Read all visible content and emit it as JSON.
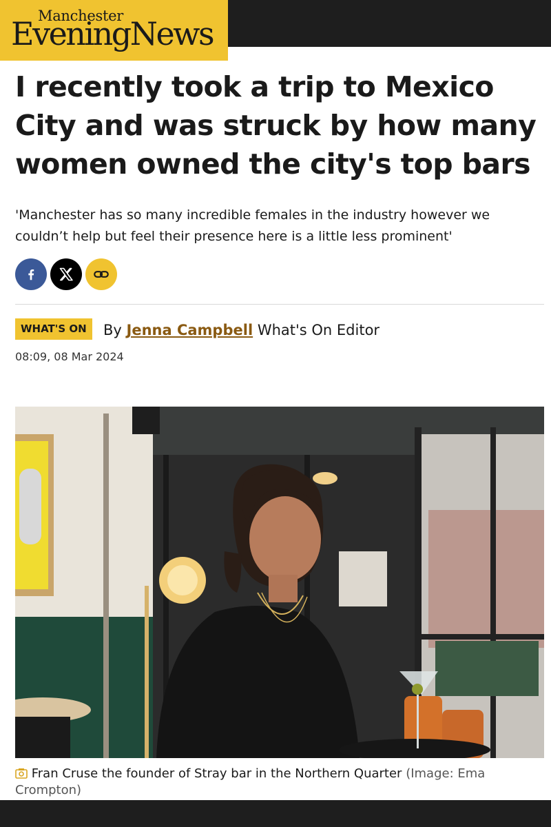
{
  "header": {
    "logo_small": "Manchester",
    "logo_big": "EveningNews"
  },
  "article": {
    "headline": "I recently took a trip to Mexico City and was struck by how many women owned the city's top bars",
    "standfirst": "'Manchester has so many incredible females in the industry however we couldn’t help but feel their presence here is a little less prominent'",
    "share": [
      {
        "name": "facebook",
        "icon": "facebook-icon",
        "color": "#3b5998"
      },
      {
        "name": "x",
        "icon": "x-icon",
        "color": "#000000"
      },
      {
        "name": "copy-link",
        "icon": "link-icon",
        "color": "#f0c330"
      }
    ],
    "section_tag": "WHAT'S ON",
    "byline_prefix": "By",
    "author": "Jenna Campbell",
    "author_role": "What's On Editor",
    "timestamp": "08:09, 08 Mar 2024",
    "image": {
      "icon": "camera-icon",
      "caption": "Fran Cruse the founder of Stray bar in the Northern Quarter",
      "credit": "(Image: Ema Crompton)"
    }
  },
  "colors": {
    "brand_yellow": "#f0c330",
    "topbar": "#1e1e1e",
    "author_link": "#8a5a12"
  }
}
